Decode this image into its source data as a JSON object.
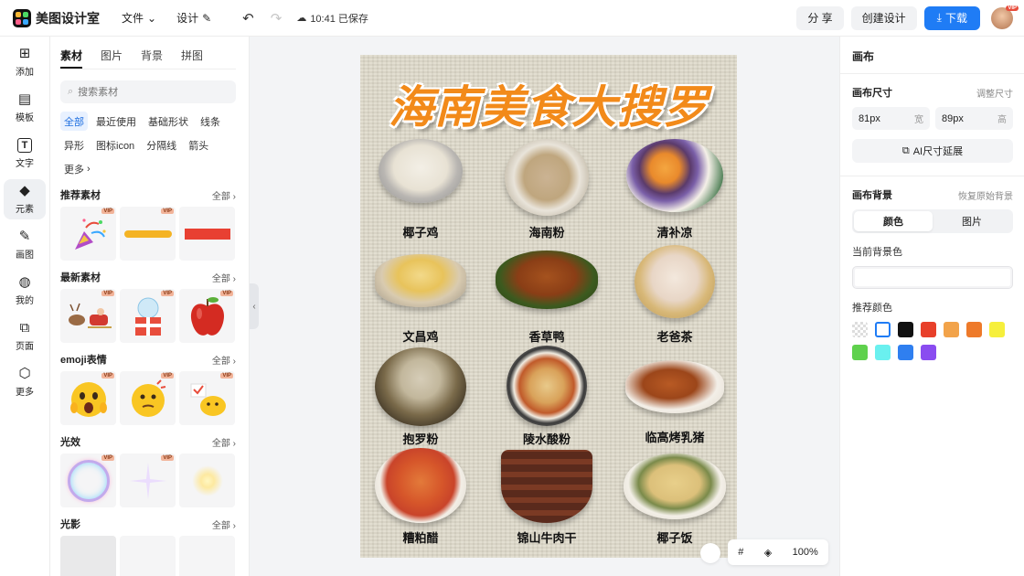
{
  "app": {
    "name": "美图设计室"
  },
  "menu": {
    "file": "文件",
    "design": "设计"
  },
  "status": {
    "saved": "10:41 已保存"
  },
  "actions": {
    "share": "分 享",
    "create": "创建设计",
    "download": "下载"
  },
  "avatar": {
    "badge": "VIP"
  },
  "rail": [
    {
      "label": "添加",
      "icon": "plus-square-icon"
    },
    {
      "label": "模板",
      "icon": "template-icon"
    },
    {
      "label": "文字",
      "icon": "text-icon"
    },
    {
      "label": "元素",
      "icon": "shapes-icon",
      "active": true
    },
    {
      "label": "画图",
      "icon": "draw-icon"
    },
    {
      "label": "我的",
      "icon": "user-icon"
    },
    {
      "label": "页面",
      "icon": "page-add-icon"
    },
    {
      "label": "更多",
      "icon": "cube-icon"
    }
  ],
  "panel": {
    "tabs": [
      "素材",
      "图片",
      "背景",
      "拼图"
    ],
    "search_placeholder": "搜索素材",
    "chips": [
      "全部",
      "最近使用",
      "基础形状",
      "线条",
      "异形",
      "图标icon",
      "分隔线",
      "箭头",
      "更多"
    ],
    "all_label": "全部",
    "vip_badge": "VIP",
    "sections": [
      {
        "title": "推荐素材"
      },
      {
        "title": "最新素材"
      },
      {
        "title": "emoji表情"
      },
      {
        "title": "光效"
      },
      {
        "title": "光影"
      }
    ]
  },
  "poster": {
    "title": "海南美食大搜罗",
    "dishes": [
      "椰子鸡",
      "海南粉",
      "清补凉",
      "文昌鸡",
      "香草鸭",
      "老爸茶",
      "抱罗粉",
      "陵水酸粉",
      "临高烤乳猪",
      "糟粕醋",
      "锦山牛肉干",
      "椰子饭"
    ]
  },
  "rpanel": {
    "title": "画布",
    "size_label": "画布尺寸",
    "adjust_label": "调整尺寸",
    "width_value": "81px",
    "width_unit": "宽",
    "height_value": "89px",
    "height_unit": "高",
    "ai_extend": "AI尺寸延展",
    "bg_label": "画布背景",
    "restore_label": "恢复原始背景",
    "seg_color": "颜色",
    "seg_image": "图片",
    "current_bg_label": "当前背景色",
    "recommend_label": "推荐颜色",
    "swatches": [
      "transparent",
      "#ffffff",
      "#111111",
      "#e8402a",
      "#f2a34a",
      "#ee7a2a",
      "#f6ef3c",
      "#5fd14d",
      "#6af0ef",
      "#2f7ff0",
      "#8a4cf0"
    ]
  },
  "canvas_tools": {
    "zoom": "100%"
  }
}
